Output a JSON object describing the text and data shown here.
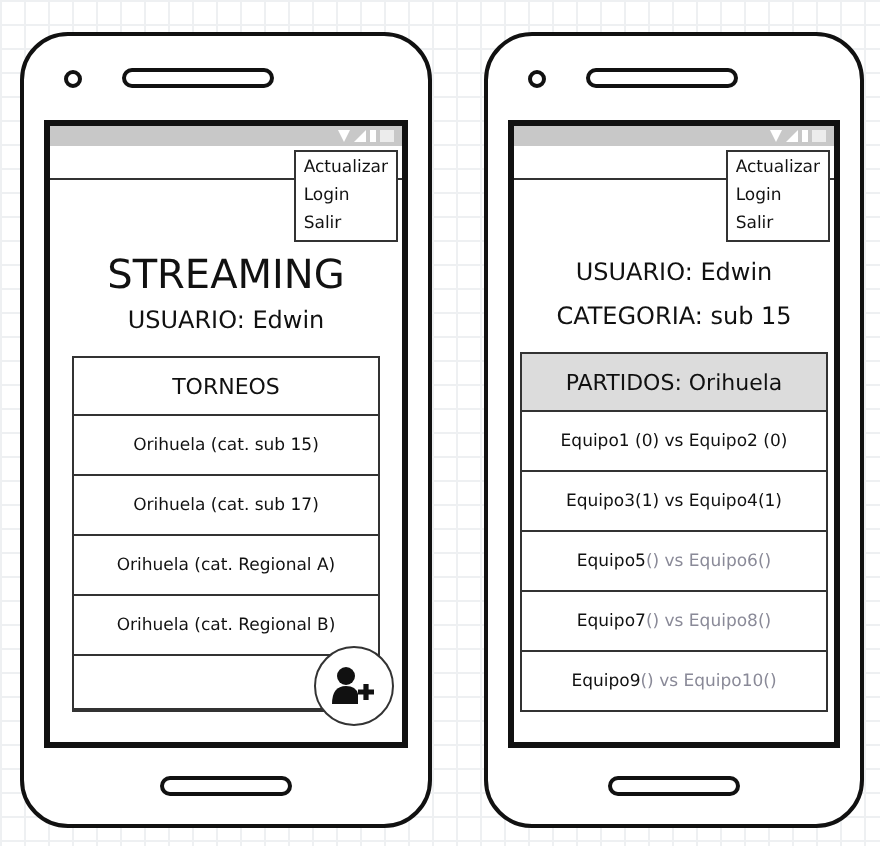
{
  "phones": [
    {
      "menu": [
        {
          "label": "Actualizar"
        },
        {
          "label": "Login"
        },
        {
          "label": "Salir"
        }
      ],
      "title": "STREAMING",
      "lines": [
        "USUARIO: Edwin"
      ],
      "list": {
        "header": "TORNEOS",
        "header_shaded": false,
        "rows": [
          {
            "parts": [
              {
                "text": "Orihuela (cat. sub 15)",
                "dim": false
              }
            ]
          },
          {
            "parts": [
              {
                "text": "Orihuela (cat. sub 17)",
                "dim": false
              }
            ]
          },
          {
            "parts": [
              {
                "text": "Orihuela (cat. Regional A)",
                "dim": false
              }
            ]
          },
          {
            "parts": [
              {
                "text": "Orihuela (cat. Regional B)",
                "dim": false
              }
            ]
          }
        ],
        "empty_row": true
      },
      "fab": true
    },
    {
      "menu": [
        {
          "label": "Actualizar"
        },
        {
          "label": "Login"
        },
        {
          "label": "Salir"
        }
      ],
      "lines": [
        "USUARIO: Edwin",
        "CATEGORIA: sub 15"
      ],
      "list": {
        "header": "PARTIDOS: Orihuela",
        "header_shaded": true,
        "rows": [
          {
            "parts": [
              {
                "text": "Equipo1 (0) vs Equipo2 (0)",
                "dim": false
              }
            ]
          },
          {
            "parts": [
              {
                "text": "Equipo3(1) vs Equipo4(1)",
                "dim": false
              }
            ]
          },
          {
            "parts": [
              {
                "text": "Equipo5",
                "dim": false
              },
              {
                "text": "() vs Equipo6()",
                "dim": true
              }
            ]
          },
          {
            "parts": [
              {
                "text": "Equipo7",
                "dim": false
              },
              {
                "text": "() vs Equipo8()",
                "dim": true
              }
            ]
          },
          {
            "parts": [
              {
                "text": "Equipo9",
                "dim": false
              },
              {
                "text": "() vs Equipo10()",
                "dim": true
              }
            ]
          }
        ],
        "empty_row": false
      },
      "fab": false
    }
  ]
}
